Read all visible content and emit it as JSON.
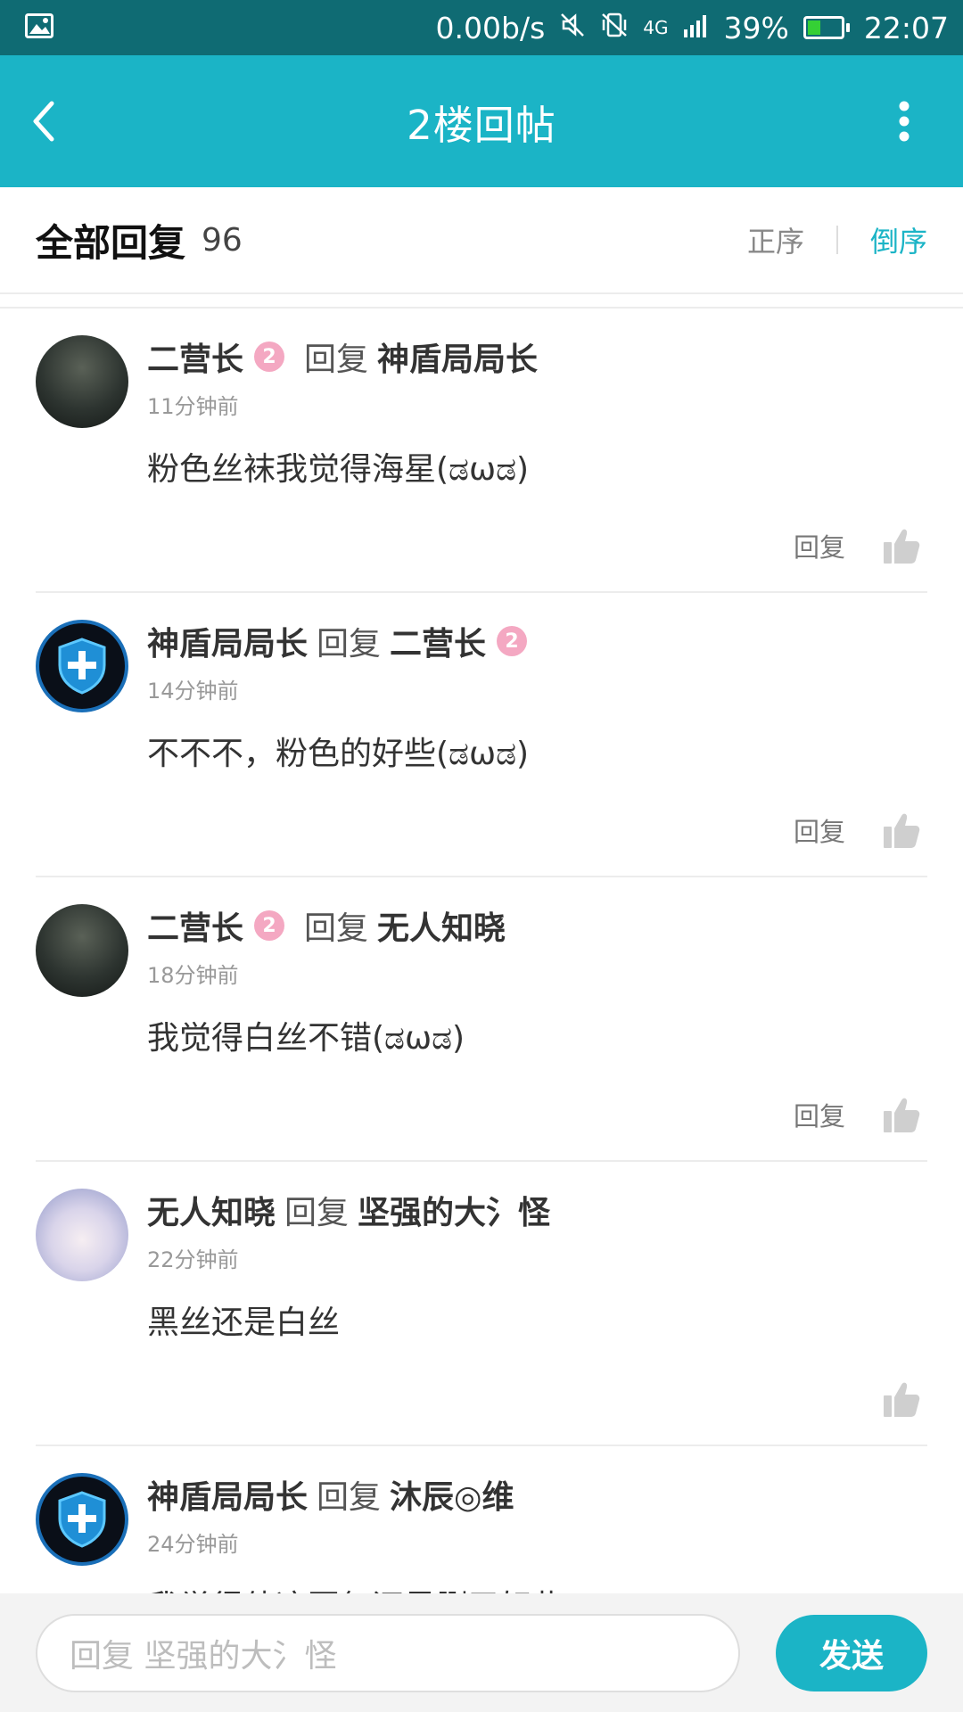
{
  "status_bar": {
    "net_speed": "0.00b/s",
    "network": "4G",
    "battery": "39%",
    "battery_level": 0.39,
    "time": "22:07"
  },
  "app_bar": {
    "title": "2楼回帖",
    "back_icon": "chevron-left-icon",
    "more_icon": "more-vertical-icon"
  },
  "header": {
    "title": "全部回复",
    "count": "96",
    "sort_asc": "正序",
    "sort_desc": "倒序"
  },
  "colors": {
    "accent": "#1bb4c6",
    "status_bar": "#0f6b73",
    "level_badge": "#f4a8c2"
  },
  "replies": [
    {
      "user": "二营长",
      "level": "2",
      "reply_word": "回复",
      "target": "神盾局局长",
      "time": "11分钟前",
      "text": "粉色丝袜我觉得海星(ಡωಡ)",
      "reply_label": "回复"
    },
    {
      "user": "神盾局局长",
      "reply_word": "回复",
      "target": "二营长",
      "target_level": "2",
      "time": "14分钟前",
      "text": "不不不，粉色的好些(ಡωಡ)",
      "reply_label": "回复"
    },
    {
      "user": "二营长",
      "level": "2",
      "reply_word": "回复",
      "target": "无人知晓",
      "time": "18分钟前",
      "text": "我觉得白丝不错(ಡωಡ)",
      "reply_label": "回复"
    },
    {
      "user": "无人知晓",
      "reply_word": "回复",
      "target": "坚强的大氵怪",
      "time": "22分钟前",
      "text": "黑丝还是白丝"
    },
    {
      "user": "神盾局局长",
      "reply_word": "回复",
      "target": "沐辰◎维",
      "time": "24分钟前",
      "text": "我觉得他这回复还是删了好些(ಡωಡ)"
    }
  ],
  "input": {
    "placeholder": "回复 坚强的大氵怪",
    "send_label": "发送"
  }
}
